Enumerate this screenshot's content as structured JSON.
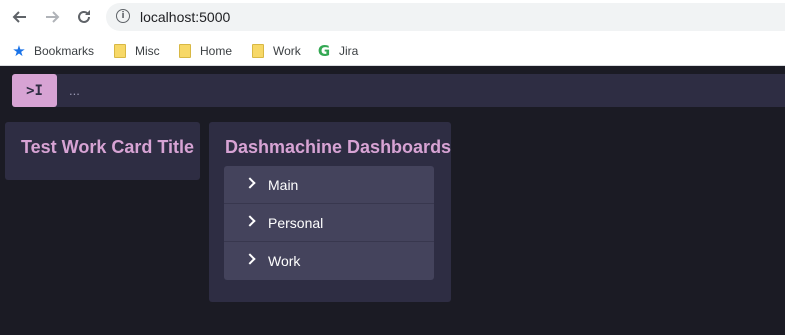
{
  "browser": {
    "url": "localhost:5000",
    "bookmarks": [
      {
        "label": "Bookmarks",
        "icon": "star-icon"
      },
      {
        "label": "Misc",
        "icon": "folder-icon"
      },
      {
        "label": "Home",
        "icon": "folder-icon"
      },
      {
        "label": "Work",
        "icon": "folder-icon"
      },
      {
        "label": "Jira",
        "icon": "g-icon"
      }
    ]
  },
  "app": {
    "toggle_label": ">I",
    "breadcrumb": "...",
    "cards": [
      {
        "title": "Test Work Card Title"
      },
      {
        "title": "Dashmachine Dashboards",
        "items": [
          "Main",
          "Personal",
          "Work"
        ]
      }
    ]
  },
  "colors": {
    "accent": "#d7a3d4",
    "background": "#1b1b24",
    "card": "#2e2d43",
    "list": "#44435c"
  }
}
